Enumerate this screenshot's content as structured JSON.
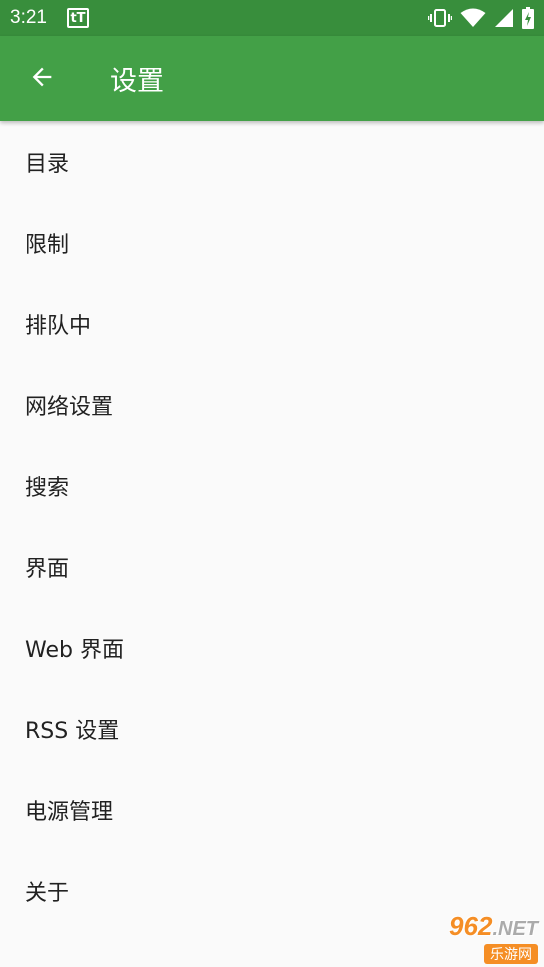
{
  "status_bar": {
    "time": "3:21",
    "notification_icon_text": "tT",
    "icons": [
      "vibrate-icon",
      "wifi-icon",
      "signal-icon",
      "battery-charging-icon"
    ]
  },
  "app_bar": {
    "title": "设置",
    "back_icon": "arrow-back-icon"
  },
  "settings": {
    "items": [
      {
        "label": "目录"
      },
      {
        "label": "限制"
      },
      {
        "label": "排队中"
      },
      {
        "label": "网络设置"
      },
      {
        "label": "搜索"
      },
      {
        "label": "界面"
      },
      {
        "label": "Web 界面"
      },
      {
        "label": "RSS 设置"
      },
      {
        "label": "电源管理"
      },
      {
        "label": "关于"
      }
    ]
  },
  "watermark": {
    "top": "962",
    "top_suffix": ".NET",
    "bottom": "乐游网"
  },
  "colors": {
    "status_bar": "#388e3c",
    "app_bar": "#43a047",
    "background": "#fafafa",
    "text": "#212121"
  }
}
